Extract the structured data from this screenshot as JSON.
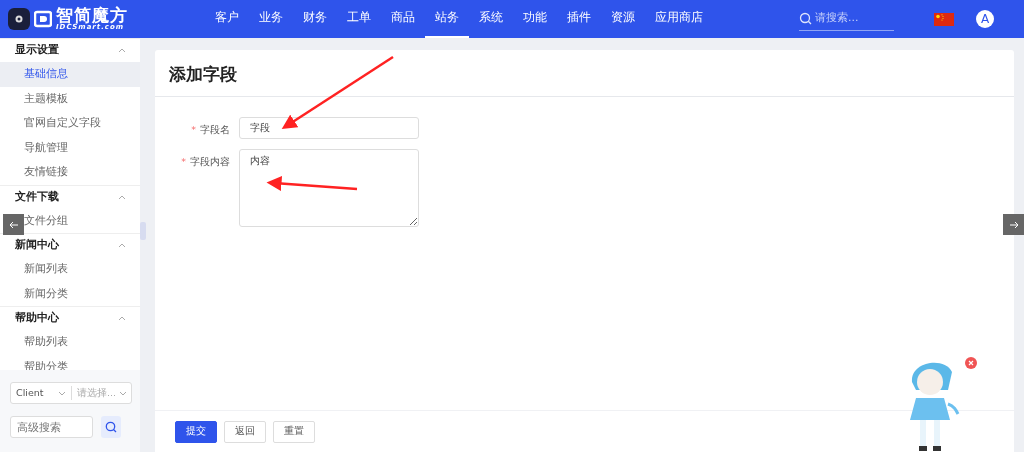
{
  "nav": {
    "logo_text": "智简魔方",
    "logo_sub": "IDCSmart.com",
    "menu": [
      {
        "label": "客户",
        "selected": false
      },
      {
        "label": "业务",
        "selected": false
      },
      {
        "label": "财务",
        "selected": false
      },
      {
        "label": "工单",
        "selected": false
      },
      {
        "label": "商品",
        "selected": false
      },
      {
        "label": "站务",
        "selected": true
      },
      {
        "label": "系统",
        "selected": false
      },
      {
        "label": "功能",
        "selected": false
      },
      {
        "label": "插件",
        "selected": false
      },
      {
        "label": "资源",
        "selected": false
      },
      {
        "label": "应用商店",
        "selected": false
      }
    ],
    "search": {
      "placeholder": "请搜索..."
    },
    "avatar": "A"
  },
  "sidebar": {
    "groups": [
      {
        "title": "显示设置",
        "expanded": true,
        "items": [
          {
            "label": "基础信息",
            "selected": true
          },
          {
            "label": "主题模板",
            "selected": false
          },
          {
            "label": "官网自定义字段",
            "selected": false
          },
          {
            "label": "导航管理",
            "selected": false
          },
          {
            "label": "友情链接",
            "selected": false
          }
        ]
      },
      {
        "title": "文件下载",
        "expanded": true,
        "items": [
          {
            "label": "文件分组",
            "selected": false
          }
        ]
      },
      {
        "title": "新闻中心",
        "expanded": true,
        "items": [
          {
            "label": "新闻列表",
            "selected": false
          },
          {
            "label": "新闻分类",
            "selected": false
          }
        ]
      },
      {
        "title": "帮助中心",
        "expanded": true,
        "items": [
          {
            "label": "帮助列表",
            "selected": false
          },
          {
            "label": "帮助分类",
            "selected": false
          }
        ]
      }
    ],
    "filters": {
      "client_select": "Client",
      "option_select": {
        "placeholder": "请选择..."
      },
      "search": {
        "placeholder": "高级搜索"
      }
    }
  },
  "page": {
    "title": "添加字段",
    "fields": [
      {
        "label": "字段名",
        "required_mark": "*",
        "kind": "input",
        "value": "字段"
      },
      {
        "label": "字段内容",
        "required_mark": "*",
        "kind": "textarea",
        "value": "内容"
      }
    ],
    "buttons": [
      {
        "label": "提交",
        "primary": true
      },
      {
        "label": "返回",
        "primary": false
      },
      {
        "label": "重置",
        "primary": false
      }
    ]
  }
}
